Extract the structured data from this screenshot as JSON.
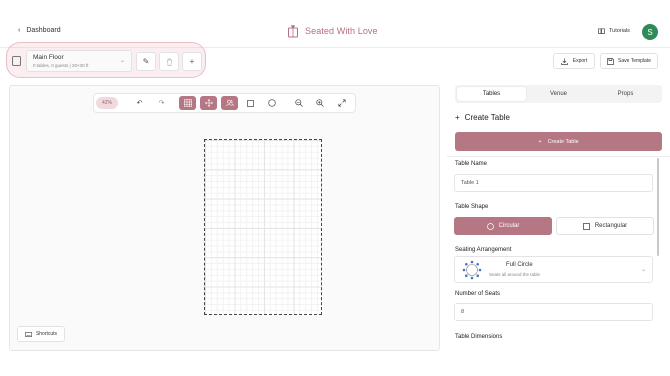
{
  "header": {
    "back_label": "Dashboard",
    "app_name": "Seated With Love",
    "tutorials_label": "Tutorials",
    "avatar_initial": "S"
  },
  "floor": {
    "name": "Main Floor",
    "meta": "0 tables, 0 guests | 20×30 ft"
  },
  "actions": {
    "export_label": "Export",
    "save_template_label": "Save Template"
  },
  "canvas": {
    "zoom_label": "42%",
    "shortcuts_label": "Shortcuts",
    "active_tools": [
      "grid",
      "pan",
      "guests"
    ]
  },
  "panel": {
    "tabs": [
      {
        "label": "Tables",
        "active": true
      },
      {
        "label": "Venue",
        "active": false
      },
      {
        "label": "Props",
        "active": false
      }
    ],
    "create_title": "Create Table",
    "create_button": "Create Table",
    "table_name_label": "Table Name",
    "table_name_placeholder": "Table 1",
    "table_shape_label": "Table Shape",
    "shape_circular": "Circular",
    "shape_rectangular": "Rectangular",
    "seating_label": "Seating Arrangement",
    "seating_title": "Full Circle",
    "seating_desc": "Seats all around the table",
    "seats_label": "Number of Seats",
    "seats_value": "8",
    "dimensions_label": "Table Dimensions"
  },
  "colors": {
    "accent": "#b67784",
    "brand": "#b5707d",
    "avatar": "#2f8a5a"
  }
}
